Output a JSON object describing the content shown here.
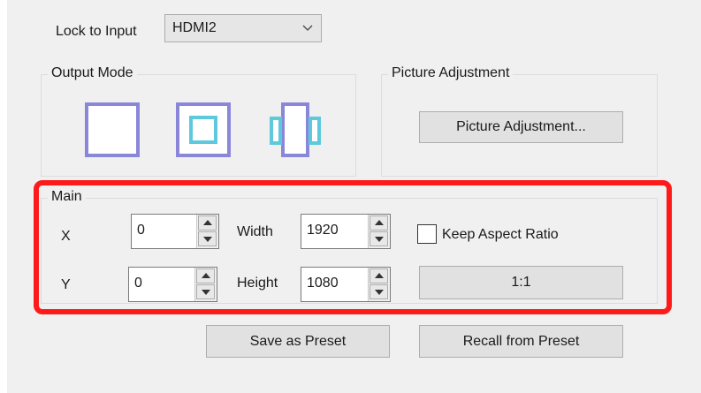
{
  "lock_to_input": {
    "label": "Lock to Input",
    "selected": "HDMI2"
  },
  "output_mode": {
    "title": "Output Mode",
    "icons": [
      "output-mode-full-icon",
      "output-mode-inset-icon",
      "output-mode-sides-icon"
    ]
  },
  "picture_adjustment": {
    "title": "Picture Adjustment",
    "button_label": "Picture Adjustment..."
  },
  "main": {
    "title": "Main",
    "x_label": "X",
    "x_value": "0",
    "y_label": "Y",
    "y_value": "0",
    "width_label": "Width",
    "width_value": "1920",
    "height_label": "Height",
    "height_value": "1080",
    "keep_aspect_label": "Keep Aspect Ratio",
    "keep_aspect_checked": false,
    "ratio_button_label": "1:1"
  },
  "actions": {
    "save_preset": "Save as Preset",
    "recall_preset": "Recall from Preset"
  },
  "colors": {
    "highlight": "#ff1a1a",
    "icon_purple": "#8a86d8",
    "icon_cyan": "#5ec9dd"
  }
}
